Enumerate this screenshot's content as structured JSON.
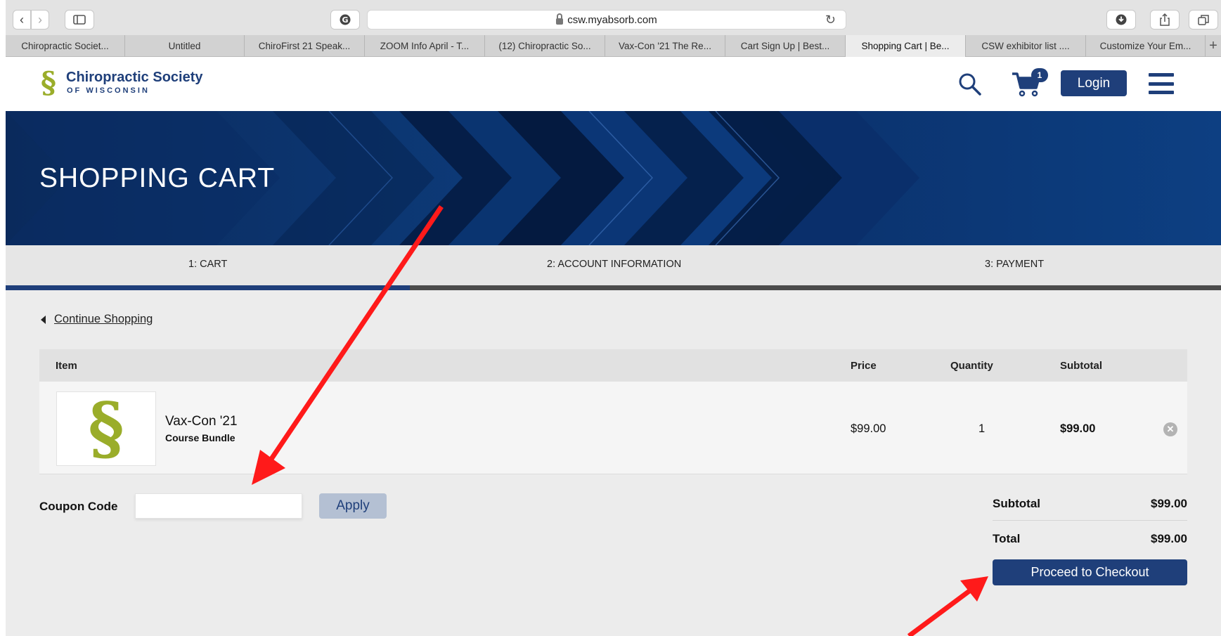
{
  "browser": {
    "url": "csw.myabsorb.com",
    "tabs": [
      {
        "label": "Chiropractic Societ...",
        "active": false
      },
      {
        "label": "Untitled",
        "active": false
      },
      {
        "label": "ChiroFirst 21 Speak...",
        "active": false
      },
      {
        "label": "ZOOM Info April - T...",
        "active": false
      },
      {
        "label": "(12) Chiropractic So...",
        "active": false
      },
      {
        "label": "Vax-Con '21 The Re...",
        "active": false
      },
      {
        "label": "Cart Sign Up | Best...",
        "active": false
      },
      {
        "label": "Shopping Cart | Be...",
        "active": true
      },
      {
        "label": "CSW exhibitor list ....",
        "active": false
      },
      {
        "label": "Customize Your Em...",
        "active": false
      }
    ],
    "icons": [
      "back-icon",
      "forward-icon",
      "sidebar-icon",
      "grammarly-icon",
      "lock-icon",
      "reload-icon",
      "download-icon",
      "share-icon",
      "tabs-overview-icon",
      "new-tab-icon"
    ]
  },
  "header": {
    "logo_mark": "§",
    "logo_title": "Chiropractic Society",
    "logo_subtitle": "OF WISCONSIN",
    "cart_count": "1",
    "login_label": "Login",
    "brand_color": "#1f3f7a",
    "accent_color": "#9aad2a"
  },
  "banner": {
    "title": "SHOPPING CART"
  },
  "steps": [
    {
      "label": "1: CART",
      "active": true
    },
    {
      "label": "2: ACCOUNT INFORMATION",
      "active": false
    },
    {
      "label": "3: PAYMENT",
      "active": false
    }
  ],
  "continue_label": "Continue Shopping",
  "table": {
    "columns": {
      "item": "Item",
      "price": "Price",
      "quantity": "Quantity",
      "subtotal": "Subtotal"
    },
    "rows": [
      {
        "thumb_mark": "§",
        "name": "Vax-Con '21",
        "type": "Course Bundle",
        "price": "$99.00",
        "quantity": "1",
        "subtotal": "$99.00"
      }
    ]
  },
  "coupon": {
    "label": "Coupon Code",
    "value": "",
    "placeholder": "",
    "apply_label": "Apply"
  },
  "totals": {
    "subtotal_label": "Subtotal",
    "subtotal_value": "$99.00",
    "total_label": "Total",
    "total_value": "$99.00",
    "checkout_label": "Proceed to Checkout"
  },
  "annotation_color": "#ff1a1a"
}
